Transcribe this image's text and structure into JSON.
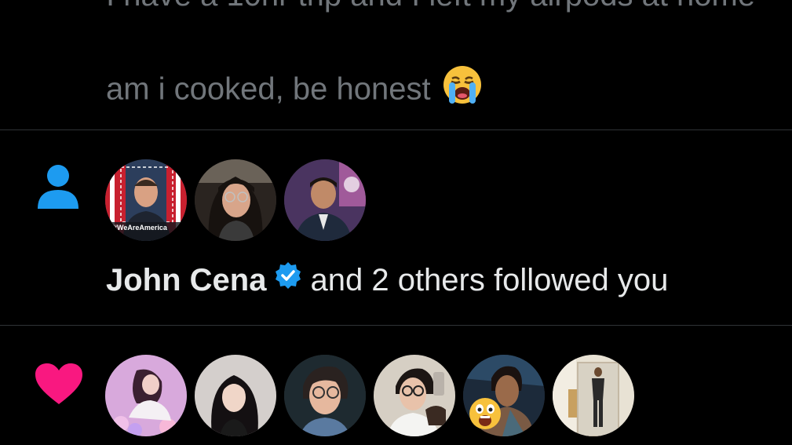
{
  "previous_tweet": {
    "line1_partial": "I have a 10hr trip and I left my airpods at home",
    "line2": "am i cooked, be honest",
    "emoji": "loudly-crying-face"
  },
  "follow_notification": {
    "icon": "person-icon",
    "icon_color": "#1d9bf0",
    "avatars": [
      {
        "name": "john-cena-avatar",
        "caption": "#WeAreAmerica"
      },
      {
        "name": "follower-2-avatar"
      },
      {
        "name": "follower-3-avatar"
      }
    ],
    "actor_name": "John Cena",
    "verified_color": "#1d9bf0",
    "text_rest": "and 2 others followed you"
  },
  "like_notification": {
    "icon": "heart-icon",
    "icon_color": "#f91880",
    "avatars": [
      {
        "name": "liker-1-avatar"
      },
      {
        "name": "liker-2-avatar"
      },
      {
        "name": "liker-3-avatar"
      },
      {
        "name": "liker-4-avatar"
      },
      {
        "name": "liker-5-avatar"
      },
      {
        "name": "liker-6-avatar"
      }
    ]
  }
}
